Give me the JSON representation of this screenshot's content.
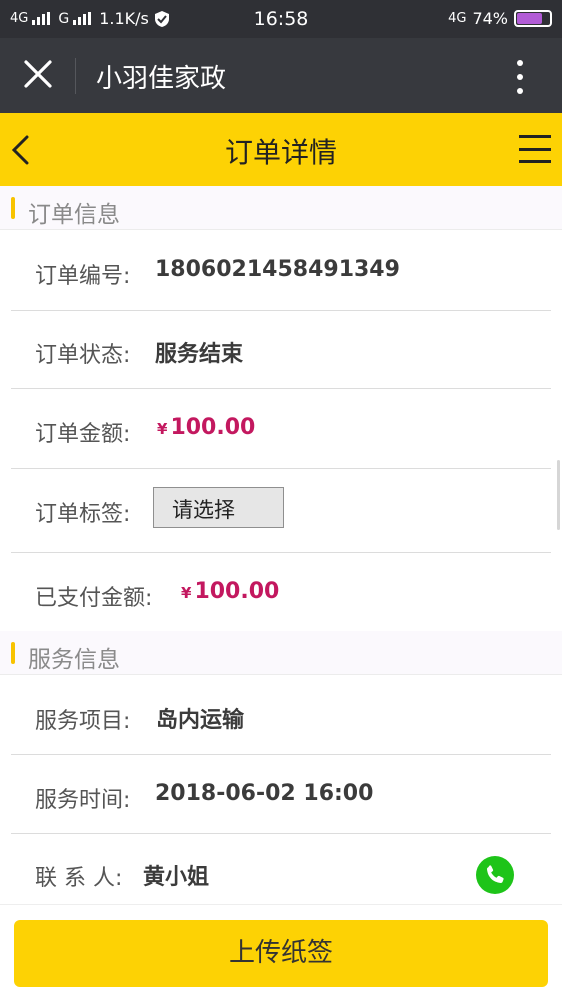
{
  "status_bar": {
    "network_1": "4G",
    "network_2": "G",
    "speed": "1.1K/s",
    "time": "16:58",
    "network_right": "4G",
    "battery": "74%",
    "battery_level": 0.74,
    "battery_color": "#b25cd6"
  },
  "wechat_bar": {
    "title": "小羽佳家政",
    "close_icon": "close-icon",
    "more_icon": "more-vertical-icon"
  },
  "header": {
    "title": "订单详情",
    "back_icon": "chevron-left-icon",
    "menu_icon": "hamburger-menu-icon",
    "accent_color": "#fdd204"
  },
  "order_section": {
    "title": "订单信息",
    "rows": [
      {
        "label": "订单编号:",
        "value": "1806021458491349"
      },
      {
        "label": "订单状态:",
        "value": "服务结束"
      },
      {
        "label": "订单金额:",
        "currency": "¥",
        "value": "100.00"
      },
      {
        "label": "订单标签:",
        "select_value": "请选择"
      },
      {
        "label": "已支付金额:",
        "currency": "¥",
        "value": "100.00"
      }
    ]
  },
  "service_section": {
    "title": "服务信息",
    "rows": [
      {
        "label": "服务项目:",
        "value": "岛内运输"
      },
      {
        "label": "服务时间:",
        "value": "2018-06-02 16:00"
      },
      {
        "label": "联 系 人:",
        "value": "黄小姐",
        "action_icon": "phone-icon"
      }
    ]
  },
  "footer": {
    "upload_label": "上传纸签"
  },
  "colors": {
    "money": "#c3185f",
    "section_accent": "#f8c300",
    "phone_green": "#1ec419"
  }
}
